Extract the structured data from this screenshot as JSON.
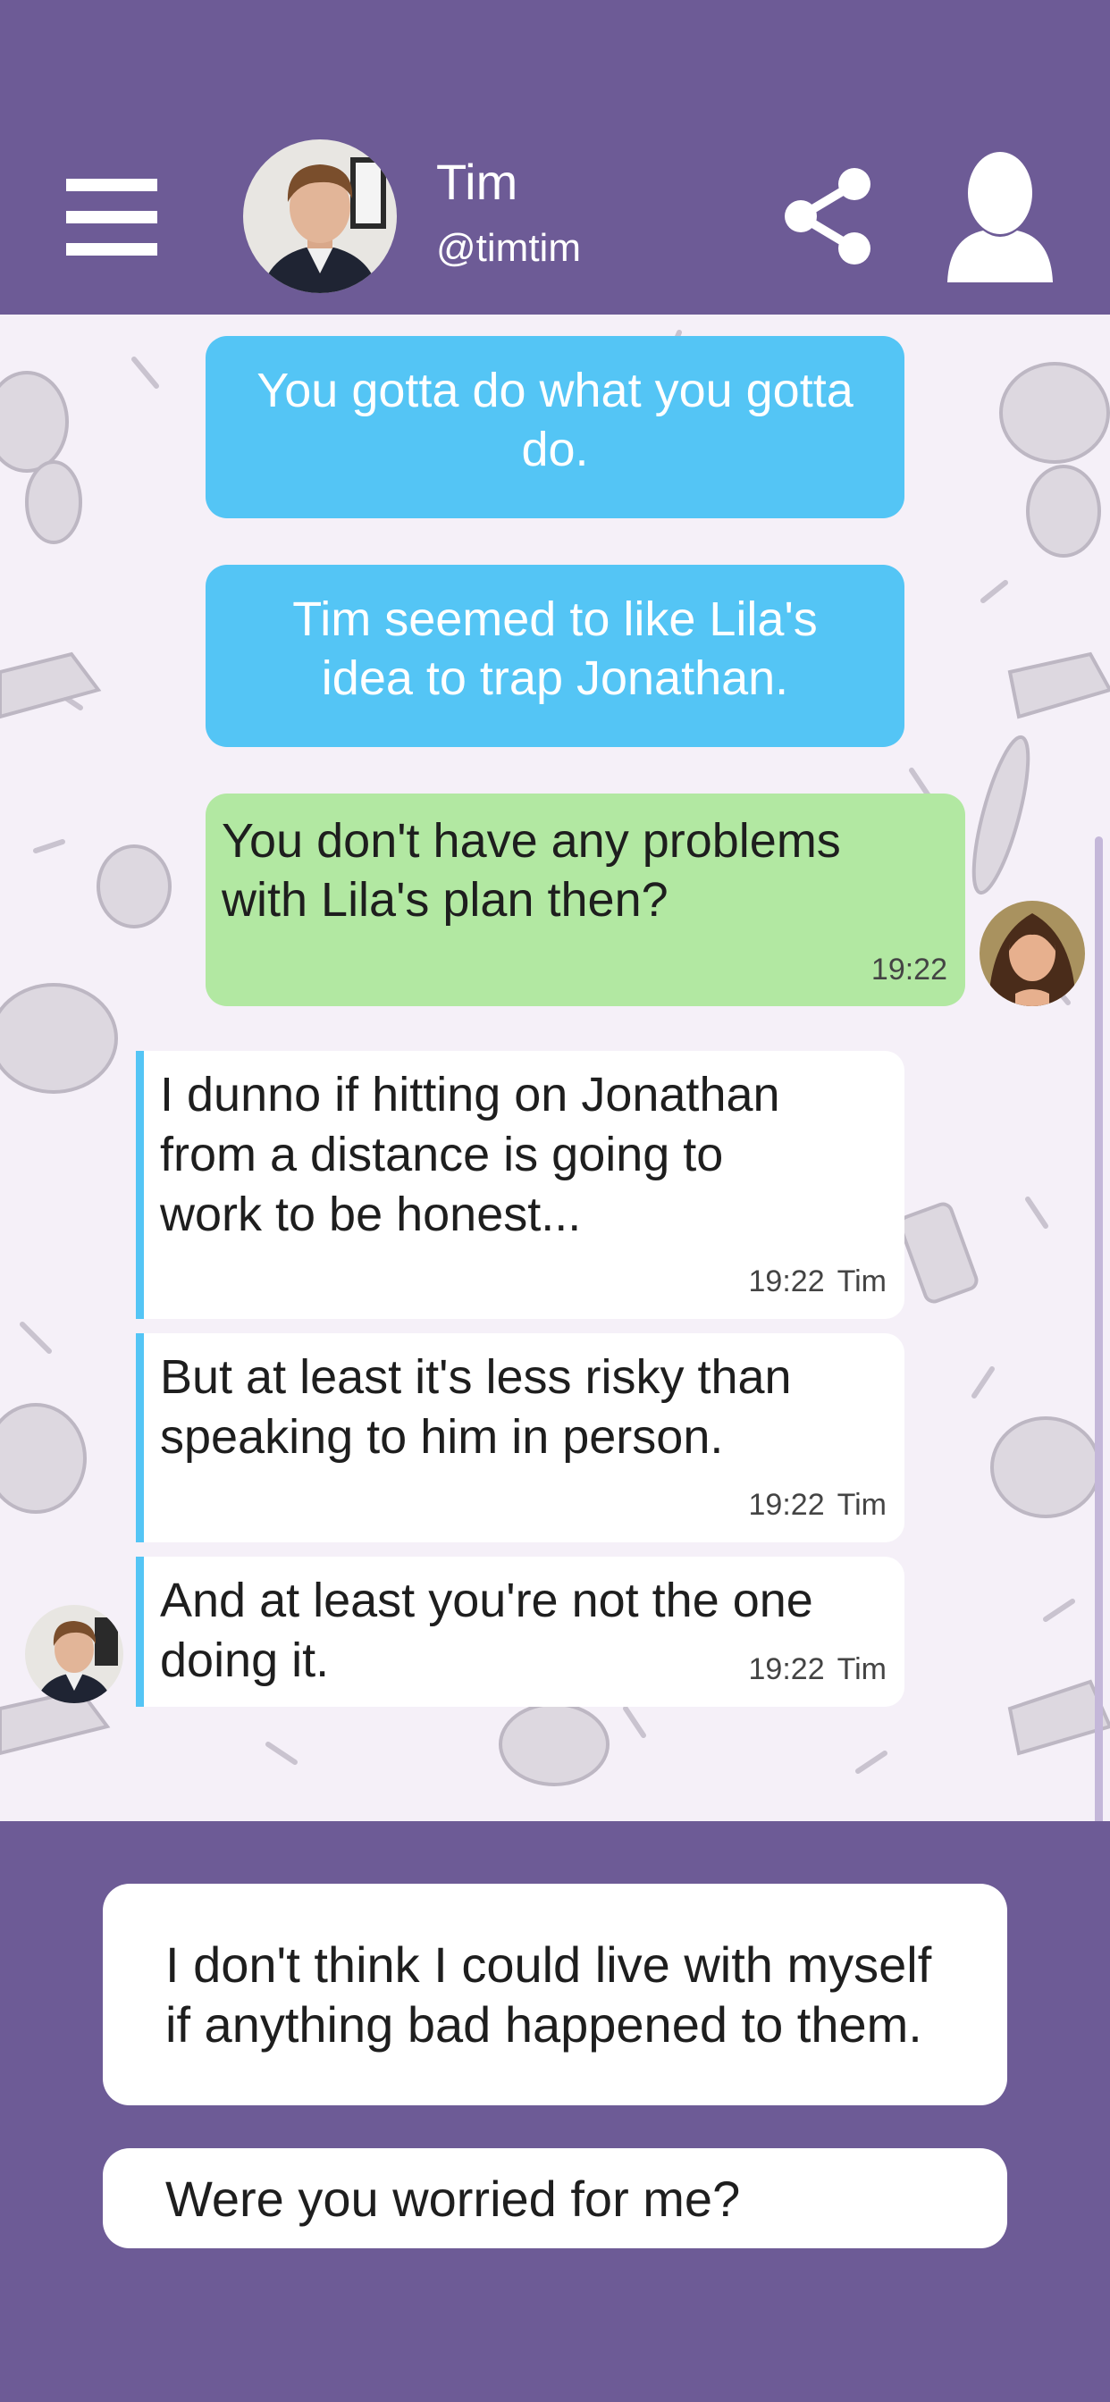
{
  "header": {
    "name": "Tim",
    "handle": "@timtim",
    "icons": [
      "menu-icon",
      "share-icon",
      "profile-icon"
    ],
    "background_color": "#6d5b96"
  },
  "chat": {
    "background_color": "#f5f0f8",
    "narration": [
      "You gotta do what you gotta do.",
      "Tim seemed to like Lila's idea to trap Jonathan."
    ],
    "sent": {
      "text": "You don't have any problems with Lila's plan then?",
      "time": "19:22"
    },
    "received": [
      {
        "text": "I dunno if hitting on Jonathan from a distance is going to work to be honest...",
        "time": "19:22",
        "sender": "Tim"
      },
      {
        "text": "But at least it's less risky than speaking to him in person.",
        "time": "19:22",
        "sender": "Tim"
      },
      {
        "text": "And at least you're not the one doing it.",
        "time": "19:22",
        "sender": "Tim"
      }
    ],
    "colors": {
      "narration_bubble": "#54c5f5",
      "sent_bubble": "#b2e8a2",
      "received_bubble": "#ffffff",
      "received_accent": "#54c5f5"
    }
  },
  "choices": [
    "I don't think I could live with myself if anything bad happened to them.",
    "Were you worried for me?"
  ]
}
